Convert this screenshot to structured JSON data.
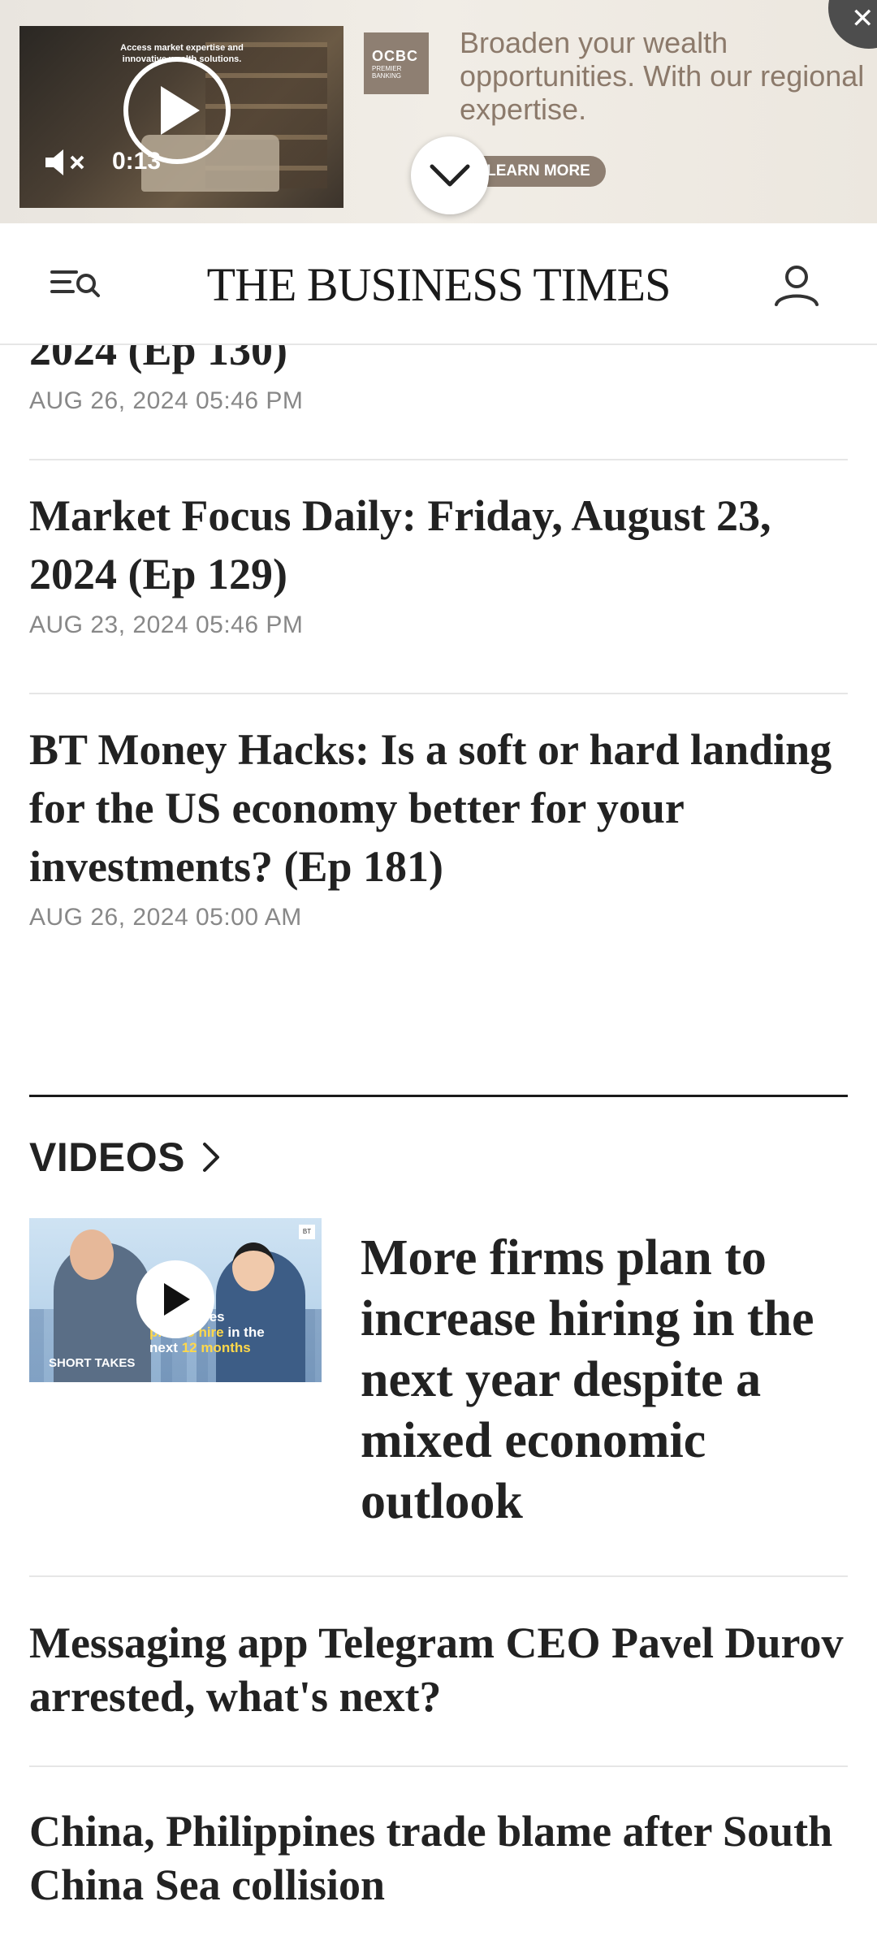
{
  "ad": {
    "video_caption": "Access market expertise and innovative wealth solutions.",
    "video_time": "0:13",
    "brand_line1": "OCBC",
    "brand_line2": "PREMIER",
    "brand_line3": "BANKING",
    "headline": "Broaden your wealth opportunities. With our regional expertise.",
    "cta": "LEARN MORE"
  },
  "header": {
    "logo": "THE BUSINESS TIMES"
  },
  "articles": [
    {
      "title": "2024 (Ep 130)",
      "date": "AUG 26, 2024 05:46 PM"
    },
    {
      "title": "Market Focus Daily: Friday, August 23, 2024 (Ep 129)",
      "date": "AUG 23, 2024 05:46 PM"
    },
    {
      "title": "BT Money Hacks: Is a soft or hard landing for the US economy better for your investments? (Ep 181)",
      "date": "AUG 26, 2024 05:00 AM"
    }
  ],
  "videos": {
    "heading": "VIDEOS",
    "featured": {
      "title": "More firms plan to increase hiring in the next year despite a mixed economic outlook",
      "thumb_caption_1": "businesses",
      "thumb_caption_2": "plan to hire",
      "thumb_caption_3": " in the",
      "thumb_caption_4": "next ",
      "thumb_caption_5": "12 months",
      "thumb_brand": "SHORT TAKES",
      "thumb_badge": "BT"
    },
    "items": [
      {
        "title": "Messaging app Telegram CEO Pavel Durov arrested, what's next?"
      },
      {
        "title": "China, Philippines trade blame after South China Sea collision"
      }
    ]
  },
  "colors": {
    "accent_ad": "#8e7f72",
    "text": "#222222",
    "date": "#888888",
    "divider": "#e6e6e6"
  }
}
